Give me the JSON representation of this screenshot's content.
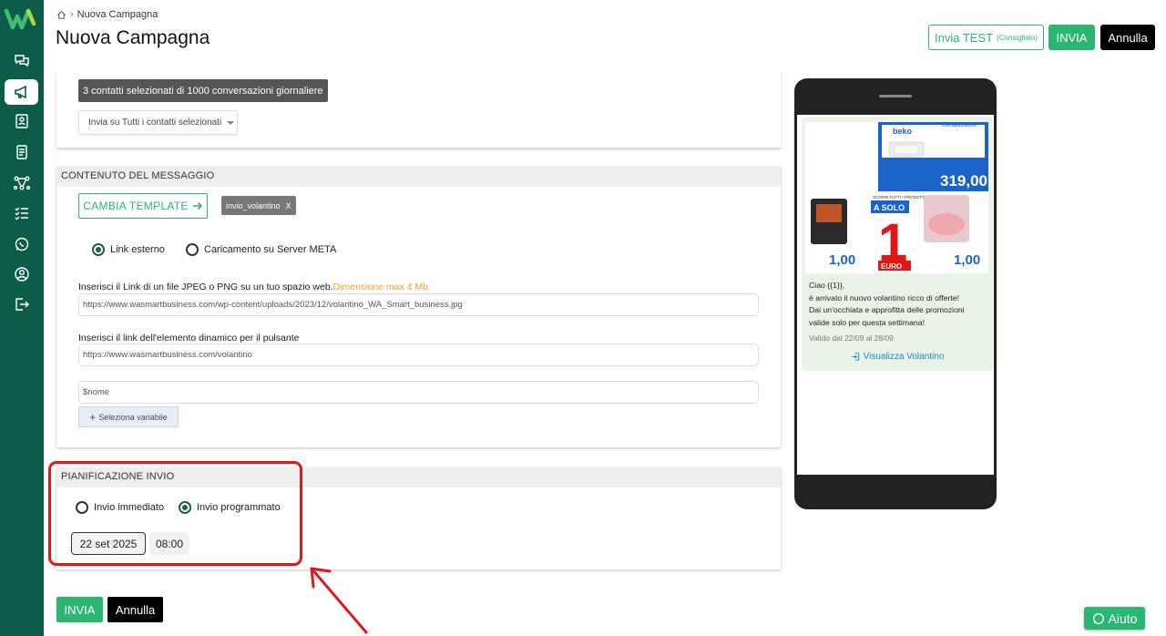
{
  "breadcrumb": {
    "current": "Nuova Campagna"
  },
  "header": {
    "title": "Nuova Campagna",
    "test_button": "Invia TEST",
    "test_button_note": "(Consigliato)",
    "send_button": "INVIA",
    "cancel_button": "Annulla"
  },
  "sidebar": {
    "icons": [
      "chat-icon",
      "megaphone-icon",
      "contacts-icon",
      "document-icon",
      "flow-icon",
      "checklist-icon",
      "whatsapp-icon",
      "user-icon",
      "logout-icon"
    ],
    "active": "megaphone-icon"
  },
  "contacts": {
    "badge": "3 contatti selezionati di 1000 conversazioni giornaliere",
    "select_value": "Invia su Tutti i contatti selezionati"
  },
  "content": {
    "heading": "CONTENUTO DEL MESSAGGIO",
    "change_template": "CAMBIA TEMPLATE",
    "template_tag": "invio_volantino",
    "template_tag_remove": "X",
    "radio_link": "Link esterno",
    "radio_upload": "Caricamento su Server META",
    "link_label": "Inserisci il Link di un file JPEG o PNG su un tuo spazio web.",
    "link_hint": "Dimensione max 4 Mb",
    "link_value": "https://www.wasmartbusiness.com/wp-content/uploads/2023/12/volantino_WA_Smart_business.jpg",
    "button_label": "Inserisci il link dell'elemento dinamico per il pulsante",
    "button_value": "https://www.wasmartbusiness.com/volantino",
    "var_value": "$nome",
    "var_button": "Seleziona variabile"
  },
  "schedule": {
    "heading": "PIANIFICAZIONE INVIO",
    "radio_now": "Invio immediato",
    "radio_scheduled": "Invio programmato",
    "date": "22 set 2025",
    "time": "08:00"
  },
  "footer": {
    "send_button": "INVIA",
    "cancel_button": "Annulla"
  },
  "preview": {
    "flyer": {
      "brand": "beko",
      "banner": "Climatizzatore",
      "price_main": "319,00",
      "promo_small": "SCOPRI TUTTI I PRODOTTI",
      "promo_label": "A SOLO",
      "promo_number": "1",
      "promo_unit": "EURO",
      "price_left": "1,00",
      "price_right": "1,00"
    },
    "message_lines": [
      "Ciao {{1}},",
      "è arrivato il nuovo volantino ricco di offerte!",
      "Dai un'occhiata e approfitta delle promozioni",
      "valide solo per questa settimana!"
    ],
    "validity": "Valido dal 22/09 al 28/09",
    "cta": "Visualizza Volantino"
  },
  "help_button": "Aiuto",
  "colors": {
    "sidebar": "#0d5c4a",
    "accent": "#2bb673",
    "highlight": "#e01818"
  }
}
